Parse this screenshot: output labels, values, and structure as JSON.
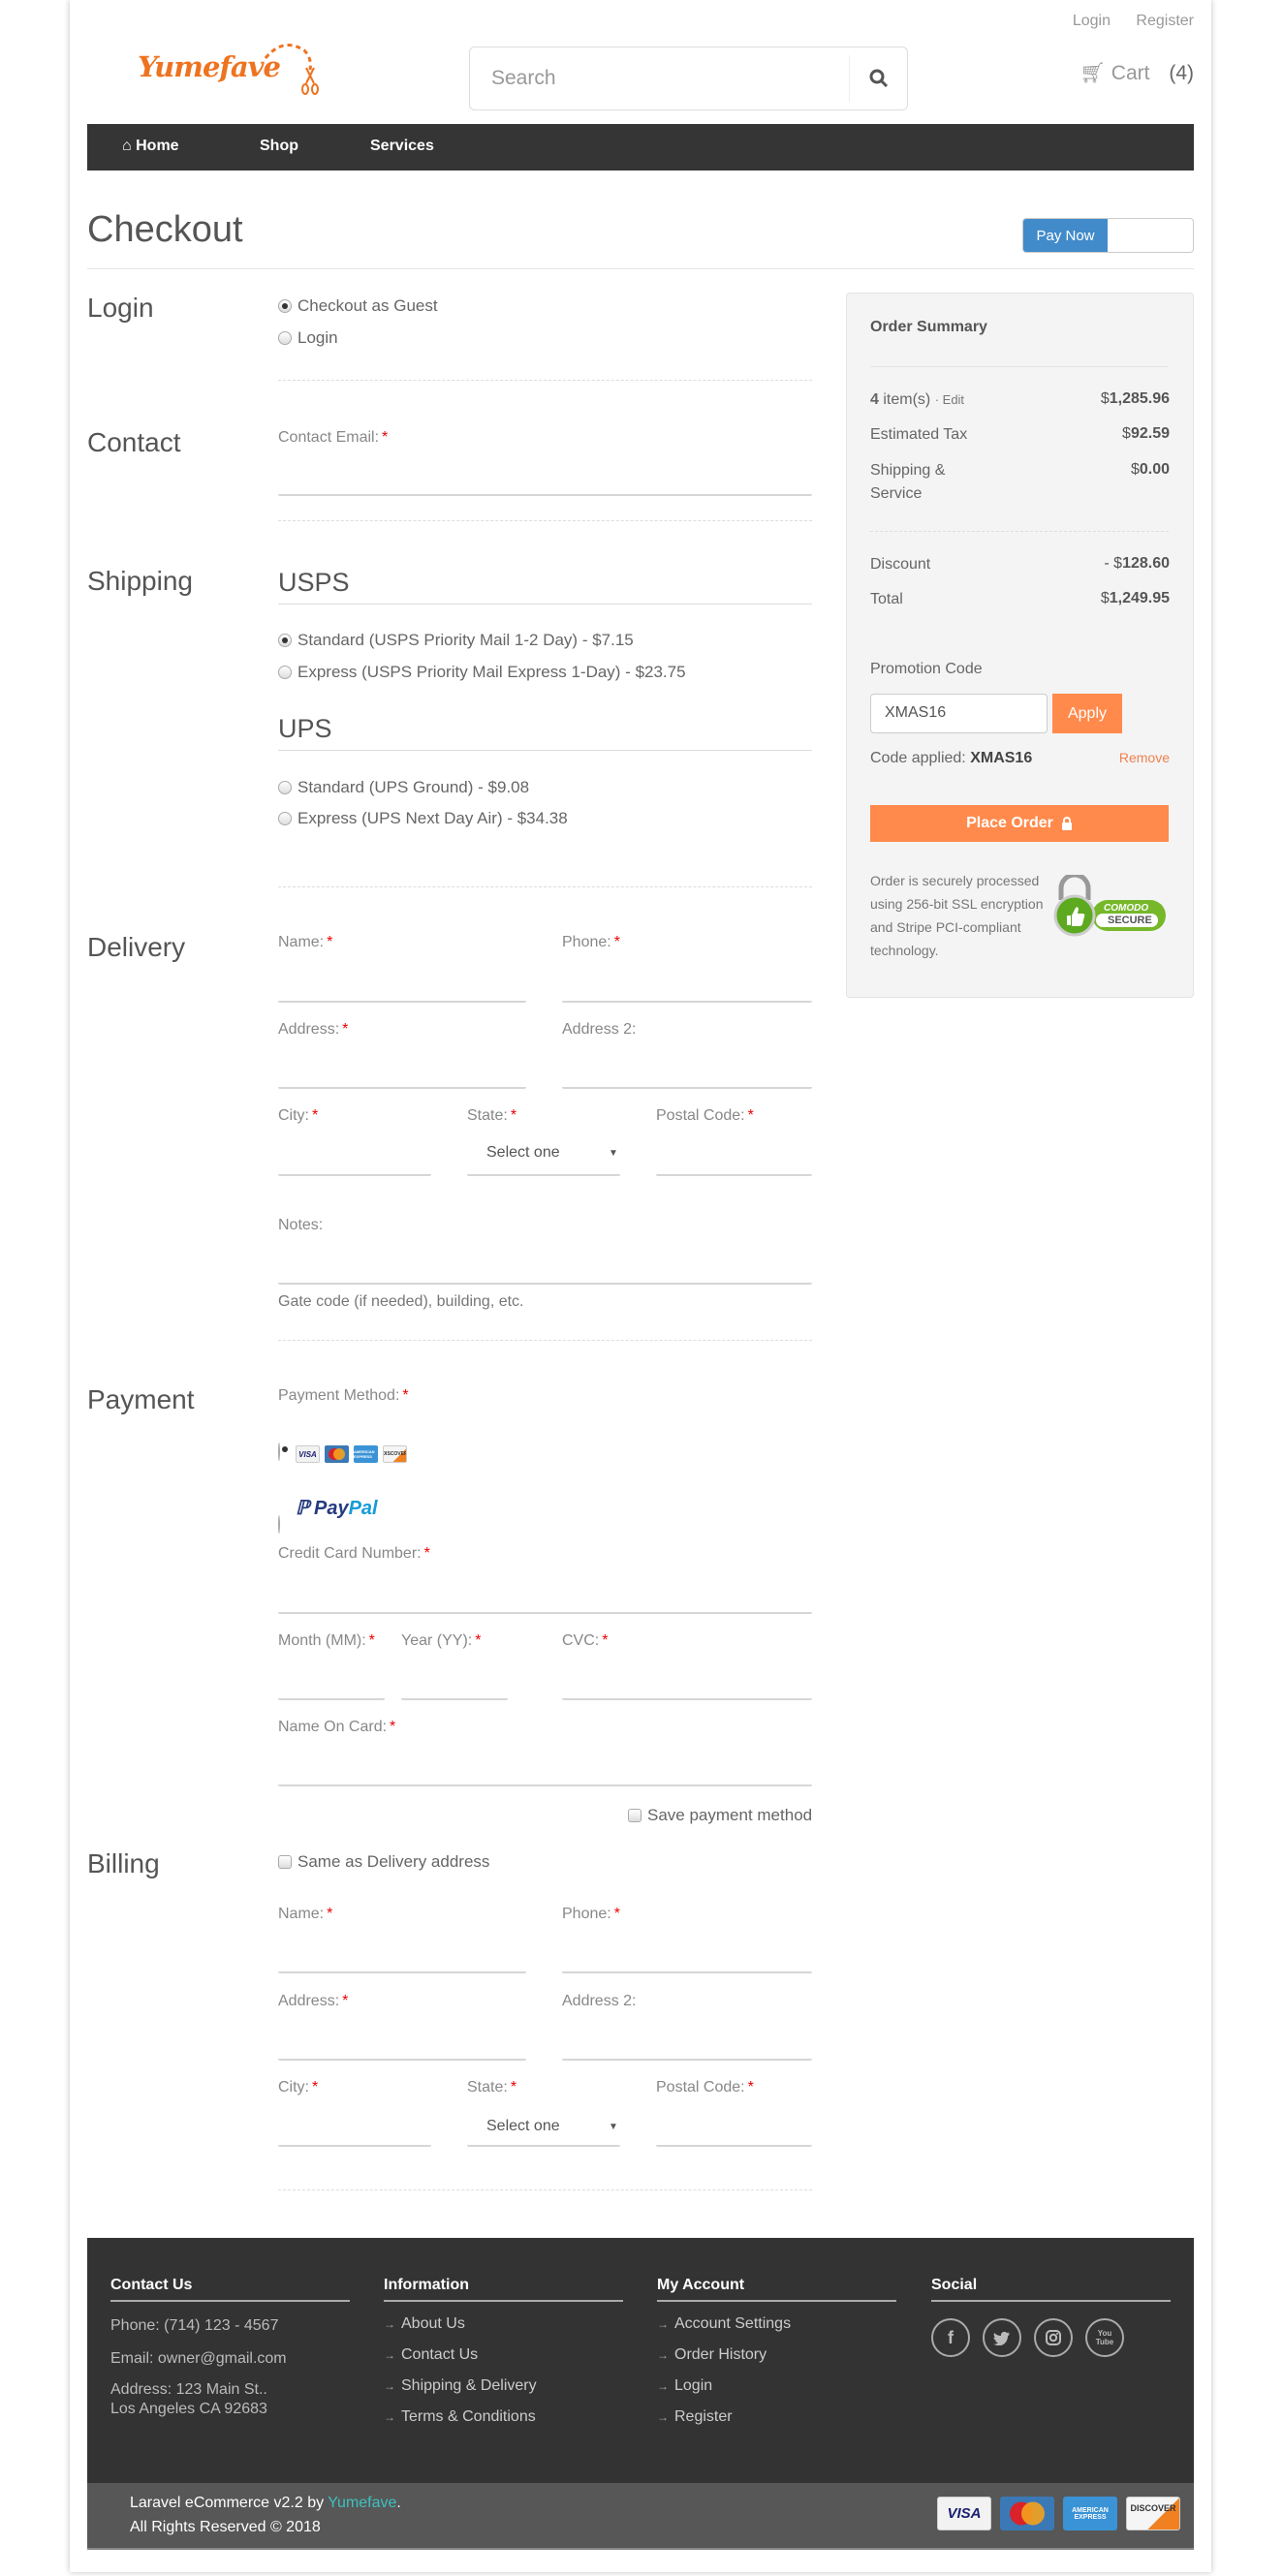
{
  "header": {
    "top_links": [
      "Login",
      "Register"
    ],
    "logo_text": "Yumefave",
    "search_placeholder": "Search",
    "cart_label": "Cart",
    "cart_count": "(4)",
    "nav": [
      "Home",
      "Shop",
      "Services"
    ]
  },
  "page": {
    "title": "Checkout",
    "pay_now": "Pay Now"
  },
  "login": {
    "title": "Login",
    "options": [
      {
        "label": "Checkout as Guest",
        "checked": true
      },
      {
        "label": "Login",
        "checked": false
      }
    ]
  },
  "contact": {
    "title": "Contact",
    "email_label": "Contact Email:",
    "required_mark": "*"
  },
  "shipping": {
    "title": "Shipping",
    "carriers": [
      {
        "name": "USPS",
        "options": [
          {
            "label": "Standard (USPS Priority Mail 1-2 Day) - $7.15",
            "checked": true
          },
          {
            "label": "Express (USPS Priority Mail Express 1-Day) - $23.75",
            "checked": false
          }
        ]
      },
      {
        "name": "UPS",
        "options": [
          {
            "label": "Standard (UPS Ground) - $9.08",
            "checked": false
          },
          {
            "label": "Express (UPS Next Day Air) - $34.38",
            "checked": false
          }
        ]
      }
    ]
  },
  "delivery": {
    "title": "Delivery",
    "name_label": "Name:",
    "phone_label": "Phone:",
    "address_label": "Address:",
    "address2_label": "Address 2:",
    "city_label": "City:",
    "state_label": "State:",
    "state_value": "Select one",
    "postal_label": "Postal Code:",
    "notes_label": "Notes:",
    "notes_help": "Gate code (if needed), building, etc."
  },
  "payment": {
    "title": "Payment",
    "method_label": "Payment Method:",
    "methods": [
      {
        "name": "cards",
        "checked": true,
        "cards": [
          "VISA",
          "MasterCard",
          "AMERICAN EXPRESS",
          "DISCOVER"
        ]
      },
      {
        "name": "PayPal",
        "checked": false,
        "label_a": "Pay",
        "label_b": "Pal"
      }
    ],
    "card_number_label": "Credit Card Number:",
    "month_label": "Month (MM):",
    "year_label": "Year (YY):",
    "cvc_label": "CVC:",
    "name_on_card_label": "Name On Card:",
    "save_label": "Save payment method"
  },
  "billing": {
    "title": "Billing",
    "same_as_label": "Same as Delivery address",
    "name_label": "Name:",
    "phone_label": "Phone:",
    "address_label": "Address:",
    "address2_label": "Address 2:",
    "city_label": "City:",
    "state_label": "State:",
    "state_value": "Select one",
    "postal_label": "Postal Code:"
  },
  "summary": {
    "title": "Order Summary",
    "items_count": "4",
    "items_label": "item(s)",
    "edit_label": "· Edit",
    "items_total": "1,285.96",
    "tax_label": "Estimated Tax",
    "tax_value": "92.59",
    "shipping_label_1": "Shipping &",
    "shipping_label_2": "Service",
    "shipping_value": "0.00",
    "discount_label": "Discount",
    "discount_prefix": "- $",
    "discount_value": "128.60",
    "total_label": "Total",
    "total_value": "1,249.95",
    "currency": "$",
    "promo_label": "Promotion Code",
    "promo_value": "XMAS16",
    "apply_label": "Apply",
    "applied_label": "Code applied:",
    "applied_code": "XMAS16",
    "remove_label": "Remove",
    "place_order_label": "Place Order",
    "secure_text": "Order is securely processed using 256-bit SSL encryption and Stripe PCI-compliant technology.",
    "badge_line1": "COMODO",
    "badge_line2": "SECURE"
  },
  "footer": {
    "contact": {
      "title": "Contact Us",
      "phone": "Phone: (714) 123 - 4567",
      "email": "Email: owner@gmail.com",
      "address1": "Address: 123 Main St..",
      "address2": "Los Angeles CA 92683"
    },
    "information": {
      "title": "Information",
      "links": [
        "About Us",
        "Contact Us",
        "Shipping & Delivery",
        "Terms & Conditions"
      ]
    },
    "account": {
      "title": "My Account",
      "links": [
        "Account Settings",
        "Order History",
        "Login",
        "Register"
      ]
    },
    "social": {
      "title": "Social",
      "icons": [
        "facebook",
        "twitter",
        "instagram",
        "youtube"
      ]
    },
    "credit_prefix": "Laravel eCommerce v2.2 by ",
    "credit_link": "Yumefave",
    "credit_suffix": ".",
    "rights": "All Rights Reserved © 2018",
    "cards": [
      "VISA",
      "MasterCard",
      "AMERICAN EXPRESS",
      "DISCOVER"
    ]
  },
  "colors": {
    "accent_orange": "#ff8a4c",
    "pay_now_blue": "#428bca",
    "navbar": "#353535",
    "footer": "#333333",
    "link_teal": "#40c0c0"
  }
}
